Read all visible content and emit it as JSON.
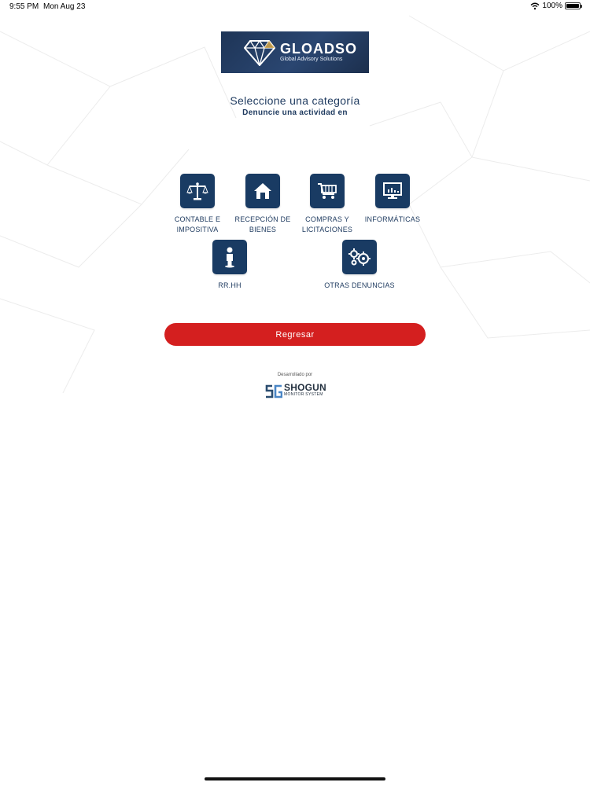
{
  "status_bar": {
    "time": "9:55 PM",
    "date": "Mon Aug 23",
    "battery": "100%"
  },
  "logo": {
    "name": "GLOADSO",
    "tagline": "Global Advisory Solutions",
    "icon": "diamond-icon"
  },
  "header": {
    "title": "Seleccione una categoría",
    "subtitle": "Denuncie una actividad en"
  },
  "categories": [
    {
      "label": "CONTABLE E IMPOSITIVA",
      "icon": "scales-icon"
    },
    {
      "label": "RECEPCIÓN DE BIENES",
      "icon": "house-icon"
    },
    {
      "label": "COMPRAS Y LICITACIONES",
      "icon": "cart-icon"
    },
    {
      "label": "INFORMÁTICAS",
      "icon": "monitor-icon"
    },
    {
      "label": "RR.HH",
      "icon": "person-icon"
    },
    {
      "label": "OTRAS DENUNCIAS",
      "icon": "gears-icon"
    }
  ],
  "actions": {
    "back_label": "Regresar"
  },
  "footer": {
    "developed_by": "Desarrollado por",
    "brand_name": "SHOGUN",
    "brand_sub": "MONITOR SYSTEM"
  },
  "colors": {
    "primary": "#193b63",
    "accent": "#d41f1f",
    "text": "#1e3a5f"
  }
}
